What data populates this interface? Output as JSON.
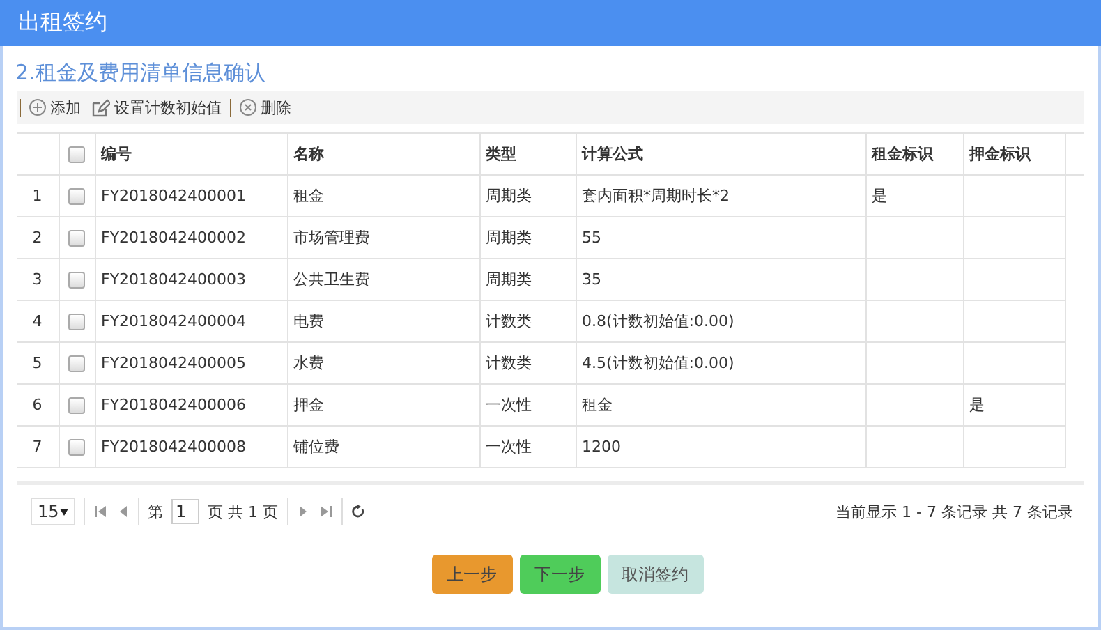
{
  "window": {
    "title": "出租签约"
  },
  "section_title": "2.租金及费用清单信息确认",
  "toolbar": [
    {
      "kind": "add",
      "label": "添加"
    },
    {
      "kind": "edit",
      "label": "设置计数初始值"
    },
    {
      "kind": "delete",
      "label": "删除"
    }
  ],
  "table": {
    "columns": [
      "编号",
      "名称",
      "类型",
      "计算公式",
      "租金标识",
      "押金标识"
    ],
    "header_checked": false,
    "rows": [
      {
        "index": "1",
        "checked": false,
        "cells": [
          "FY2018042400001",
          "租金",
          "周期类",
          "套内面积*周期时长*2",
          "是",
          ""
        ]
      },
      {
        "index": "2",
        "checked": false,
        "cells": [
          "FY2018042400002",
          "市场管理费",
          "周期类",
          "55",
          "",
          ""
        ]
      },
      {
        "index": "3",
        "checked": false,
        "cells": [
          "FY2018042400003",
          "公共卫生费",
          "周期类",
          "35",
          "",
          ""
        ]
      },
      {
        "index": "4",
        "checked": false,
        "cells": [
          "FY2018042400004",
          "电费",
          "计数类",
          "0.8(计数初始值:0.00)",
          "",
          ""
        ]
      },
      {
        "index": "5",
        "checked": false,
        "cells": [
          "FY2018042400005",
          "水费",
          "计数类",
          "4.5(计数初始值:0.00)",
          "",
          ""
        ]
      },
      {
        "index": "6",
        "checked": false,
        "cells": [
          "FY2018042400006",
          "押金",
          "一次性",
          "租金",
          "",
          "是"
        ]
      },
      {
        "index": "7",
        "checked": false,
        "cells": [
          "FY2018042400008",
          "铺位费",
          "一次性",
          "1200",
          "",
          ""
        ]
      }
    ]
  },
  "pager": {
    "page_size": "15",
    "page_prefix": "第",
    "page": "1",
    "page_suffix": "页 共 1 页",
    "info": "当前显示 1 - 7 条记录 共 7 条记录"
  },
  "buttons": [
    {
      "kind": "prev",
      "label": "上一步"
    },
    {
      "kind": "next",
      "label": "下一步"
    },
    {
      "kind": "cancel",
      "label": "取消签约"
    }
  ]
}
